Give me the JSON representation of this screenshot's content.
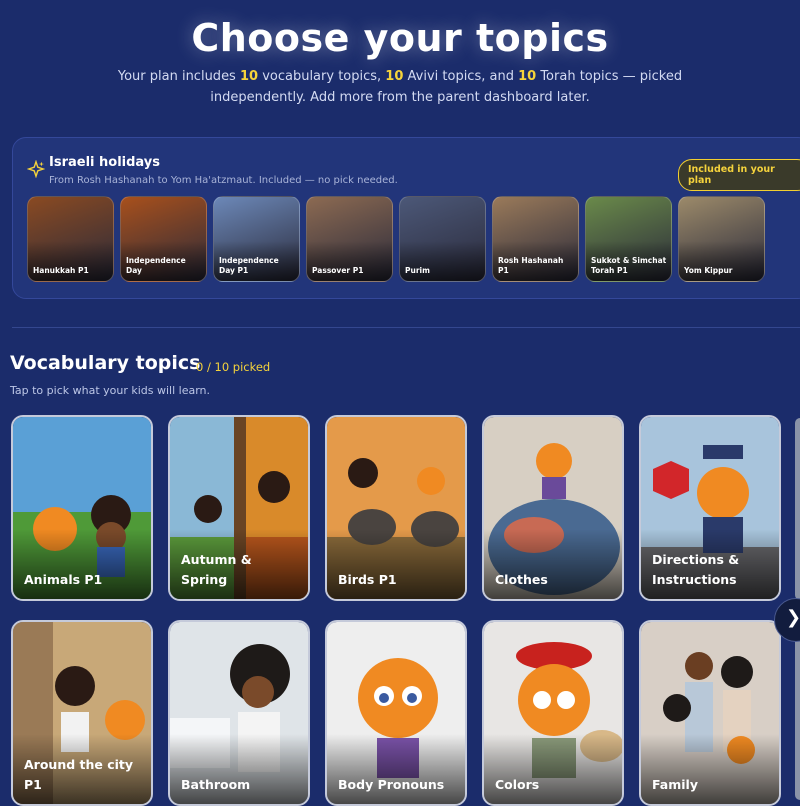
{
  "hero": {
    "title": "Choose your topics",
    "sub_pre": "Your plan includes ",
    "vocab_count": "10",
    "sub_mid1": " vocabulary topics, ",
    "avivi_count": "10",
    "sub_mid2": " Avivi topics, and ",
    "torah_count": "10",
    "sub_post": " Torah topics — picked independently. Add more from the parent dashboard later."
  },
  "holidays": {
    "icon": "sparkle-icon",
    "title": "Israeli holidays",
    "subtitle": "From Rosh Hashanah to Yom Ha'atzmaut. Included — no pick needed.",
    "badge": "Included in your plan",
    "items": [
      {
        "label": "Hanukkah P1",
        "color": "#8a4a22"
      },
      {
        "label": "Independence Day",
        "color": "#a8501c"
      },
      {
        "label": "Independence Day P1",
        "color": "#6c88b8"
      },
      {
        "label": "Passover P1",
        "color": "#8c6a52"
      },
      {
        "label": "Purim",
        "color": "#4c5878"
      },
      {
        "label": "Rosh Hashanah P1",
        "color": "#9a7a5a"
      },
      {
        "label": "Sukkot & Simchat Torah P1",
        "color": "#6a8a4a"
      },
      {
        "label": "Yom Kippur",
        "color": "#9c8a6a"
      }
    ]
  },
  "vocab": {
    "title": "Vocabulary topics",
    "count": "0 / 10 picked",
    "subtitle": "Tap to pick what your kids will learn.",
    "cards": [
      {
        "label": "Animals P1"
      },
      {
        "label": "Autumn & Spring"
      },
      {
        "label": "Birds P1"
      },
      {
        "label": "Clothes"
      },
      {
        "label": "Directions & Instructions"
      },
      {
        "label": "Around the city P1"
      },
      {
        "label": "Bathroom"
      },
      {
        "label": "Body Pronouns"
      },
      {
        "label": "Colors"
      },
      {
        "label": "Family"
      }
    ],
    "next_icon": "chevron-right-icon"
  },
  "colors": {
    "accent": "#f4d23c",
    "background": "#1b2c6b"
  }
}
